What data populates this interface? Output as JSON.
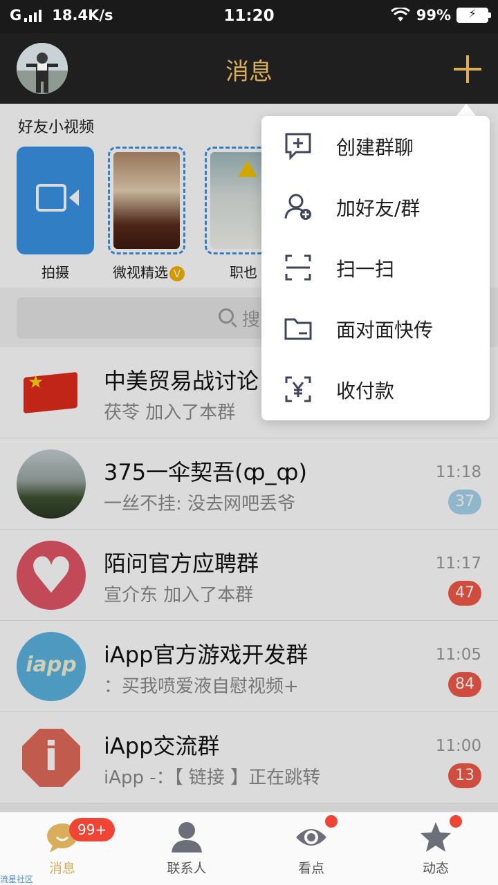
{
  "status_bar": {
    "network": "G",
    "speed": "18.4K/s",
    "time": "11:20",
    "battery": "99%"
  },
  "header": {
    "title": "消息"
  },
  "friend_videos": {
    "title": "好友小视频",
    "items": [
      {
        "label": "拍摄"
      },
      {
        "label": "微视精选",
        "badge": "V"
      },
      {
        "label": "职也"
      }
    ]
  },
  "search": {
    "placeholder": "搜"
  },
  "conversations": [
    {
      "name": "中美贸易战讨论",
      "message": "茯苓 加入了本群",
      "time": "",
      "badge": ""
    },
    {
      "name": "375一伞契吾(ȹ_ȹ)",
      "message": "一丝不挂: 没去网吧丢爷",
      "time": "11:18",
      "badge": "37",
      "muted": true
    },
    {
      "name": "陌问官方应聘群",
      "message": "宣介东 加入了本群",
      "time": "11:17",
      "badge": "47"
    },
    {
      "name": "iApp官方游戏开发群",
      "message": "：买我喷爱液自慰视频+",
      "time": "11:05",
      "badge": "84"
    },
    {
      "name": "iApp交流群",
      "message": "iApp -：【 链接 】正在跳转",
      "time": "11:00",
      "badge": "13"
    }
  ],
  "avatar_texts": {
    "iapp": "iapp",
    "info": "i",
    "star": "★",
    "heart": "♥"
  },
  "popup_menu": [
    {
      "label": "创建群聊",
      "icon": "chat-plus-icon"
    },
    {
      "label": "加好友/群",
      "icon": "add-user-icon"
    },
    {
      "label": "扫一扫",
      "icon": "scan-icon"
    },
    {
      "label": "面对面快传",
      "icon": "folder-icon"
    },
    {
      "label": "收付款",
      "icon": "yuan-scan-icon"
    }
  ],
  "tabbar": {
    "tabs": [
      {
        "label": "消息",
        "badge": "99+",
        "active": true
      },
      {
        "label": "联系人"
      },
      {
        "label": "看点",
        "dot": true
      },
      {
        "label": "动态",
        "dot": true
      }
    ]
  },
  "watermark": "流星社区",
  "colors": {
    "accent": "#d9ad5a",
    "badge_red": "#f05a4a",
    "badge_muted": "#a8d4ee",
    "header_bg": "#1f1f1f"
  }
}
